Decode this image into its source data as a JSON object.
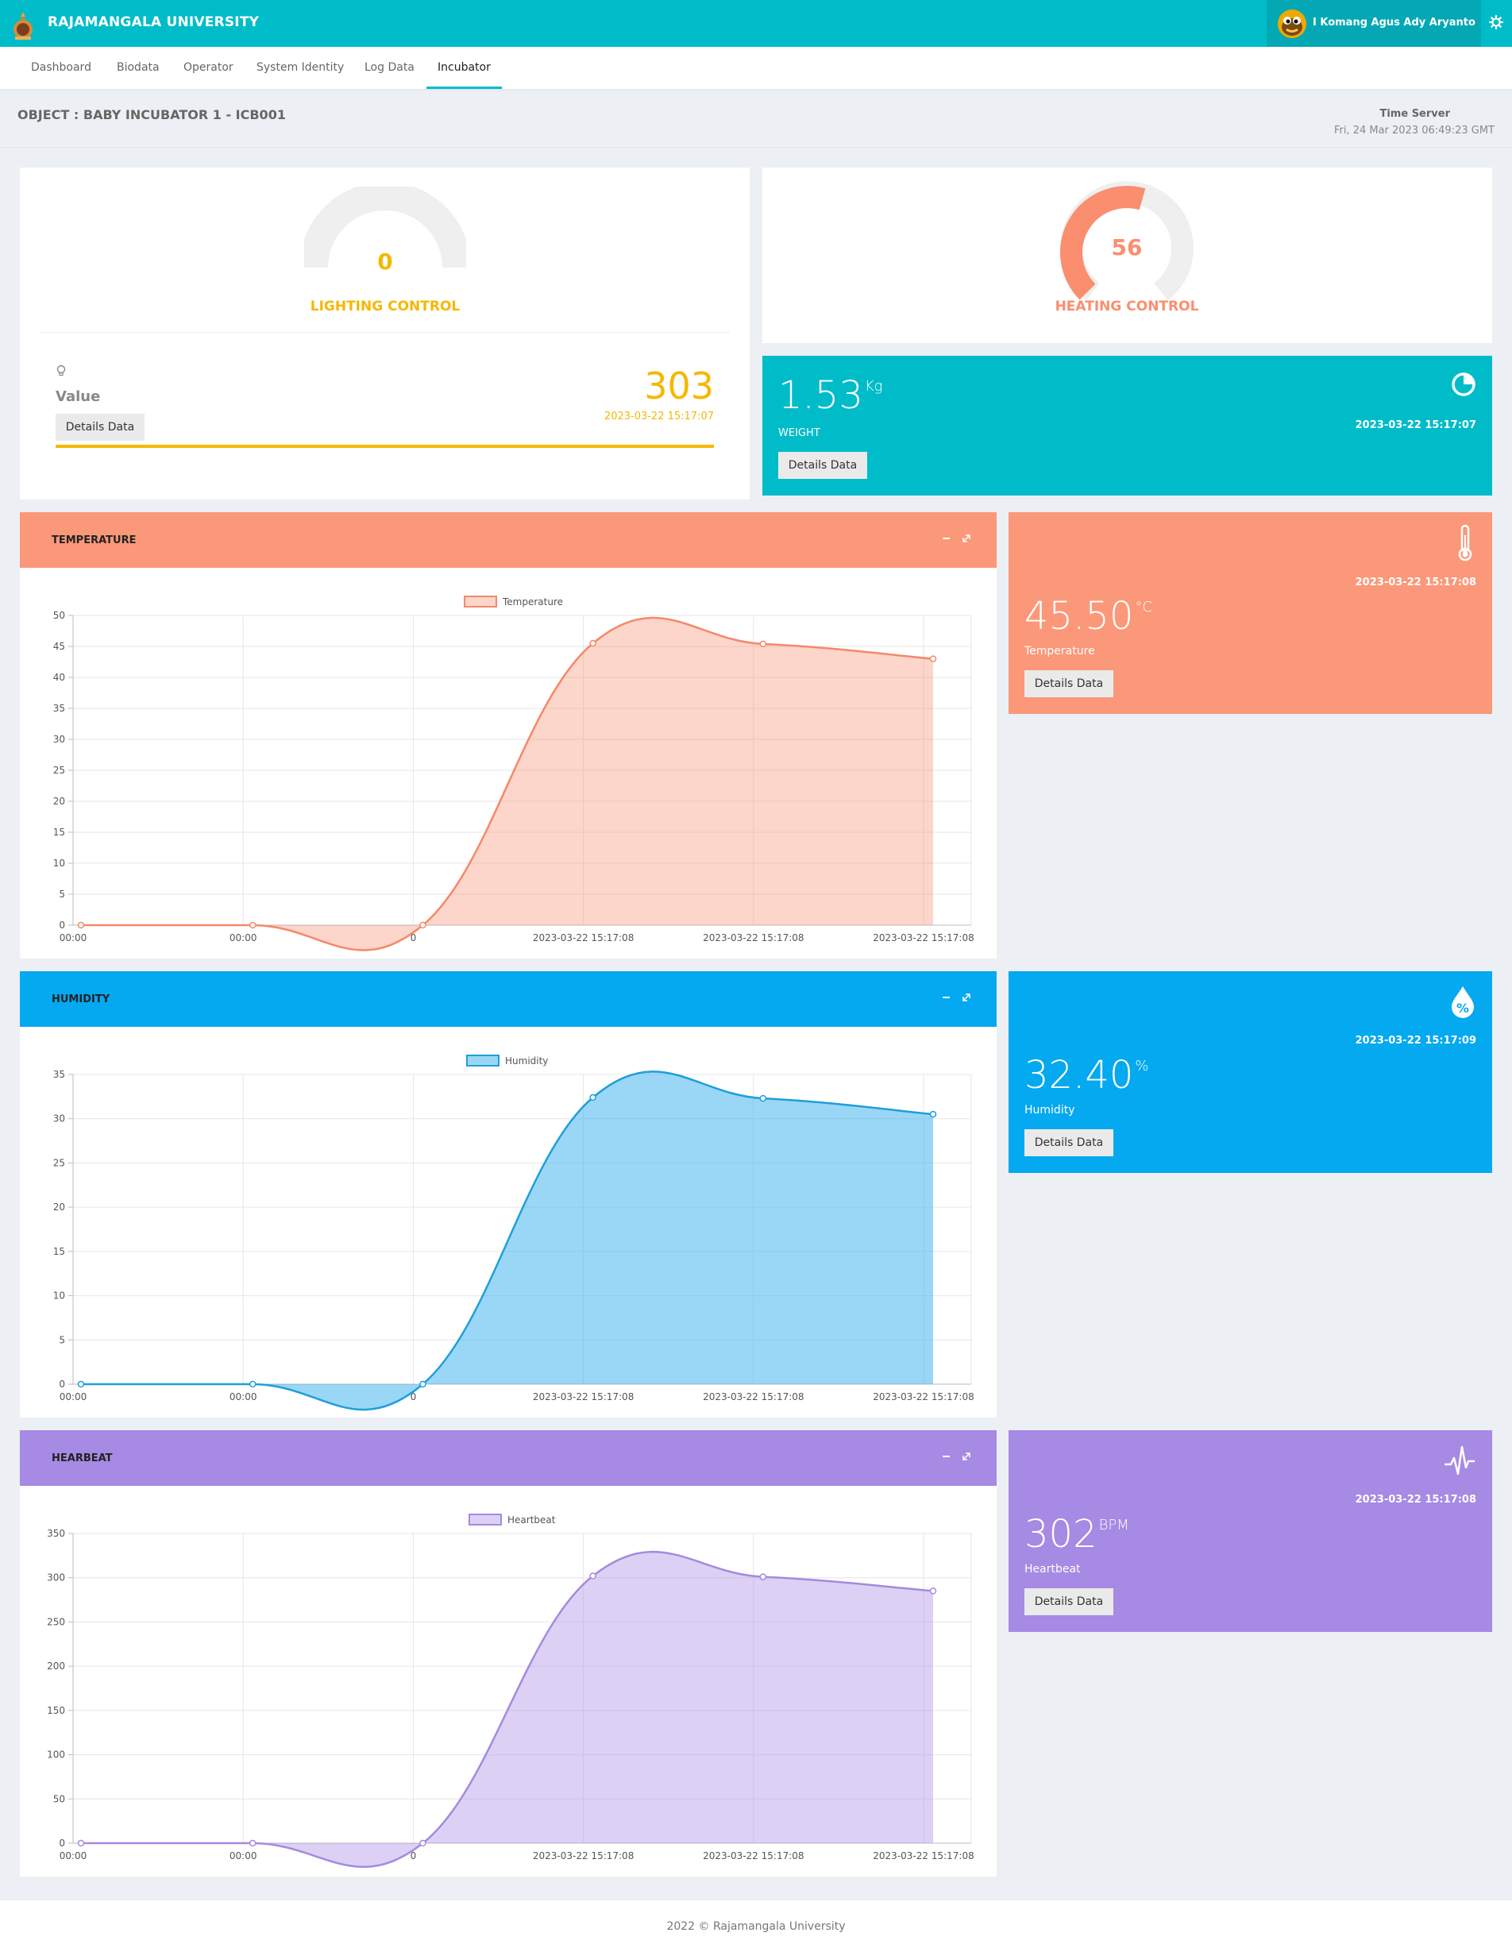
{
  "header": {
    "brand": "RAJAMANGALA UNIVERSITY",
    "user_name": "I Komang Agus Ady Aryanto",
    "icons": [
      "university-logo",
      "user-avatar",
      "gear-icon"
    ]
  },
  "nav": {
    "tabs": [
      {
        "label": "Dashboard"
      },
      {
        "label": "Biodata"
      },
      {
        "label": "Operator"
      },
      {
        "label": "System Identity"
      },
      {
        "label": "Log Data"
      },
      {
        "label": "Incubator"
      }
    ],
    "active": "Incubator"
  },
  "object": {
    "title": "OBJECT : BABY INCUBATOR 1 - ICB001",
    "time_label": "Time Server",
    "time_value": "Fri, 24 Mar 2023 06:49:23 GMT"
  },
  "lighting": {
    "gauge_value": "0",
    "gauge_fraction": 0,
    "label": "LIGHTING CONTROL",
    "value_title": "Value",
    "value": "303",
    "date": "2023-03-22 15:17:07",
    "button": "Details Data",
    "color": "#f5b800"
  },
  "heating": {
    "gauge_value": "56",
    "gauge_fraction": 0.56,
    "label": "HEATING CONTROL",
    "color": "#fa8e6e"
  },
  "weight": {
    "value": "1.53",
    "unit": "Kg",
    "label": "WEIGHT",
    "date": "2023-03-22 15:17:07",
    "button": "Details Data",
    "color": "#00bcc9",
    "icon": "moon-icon"
  },
  "temperature_widget": {
    "value": "45.50",
    "unit": "°C",
    "label": "Temperature",
    "date": "2023-03-22 15:17:08",
    "button": "Details Data",
    "color": "#fa9879",
    "icon": "thermometer-icon"
  },
  "humidity_widget": {
    "value": "32.40",
    "unit": "%",
    "label": "Humidity",
    "date": "2023-03-22 15:17:09",
    "button": "Details Data",
    "color": "#04a9ef",
    "icon": "humidity-drop-icon"
  },
  "heartbeat_widget": {
    "value": "302",
    "unit": "BPM",
    "label": "Heartbeat",
    "date": "2023-03-22 15:17:08",
    "button": "Details Data",
    "color": "#a68ae3",
    "icon": "pulse-icon"
  },
  "panels": {
    "temperature": {
      "title": "TEMPERATURE",
      "color": "#fa9879"
    },
    "humidity": {
      "title": "HUMIDITY",
      "color": "#04a9ef"
    },
    "heartbeat": {
      "title": "HEARBEAT",
      "color": "#a68ae3"
    }
  },
  "chart_data": [
    {
      "type": "area",
      "x": [
        "00:00",
        "00:00",
        "0",
        "2023-03-22 15:17:08",
        "2023-03-22 15:17:08",
        "2023-03-22 15:17:08"
      ],
      "series": [
        {
          "name": "Temperature",
          "values": [
            0,
            0,
            0,
            45.5,
            45.4,
            43
          ]
        }
      ],
      "ylim": [
        0,
        50
      ],
      "yticks": [
        0,
        5,
        10,
        15,
        20,
        25,
        30,
        35,
        40,
        45,
        50
      ],
      "color": "#f4896a",
      "fill": "rgba(247,145,118,0.38)",
      "legend": "top-center",
      "grid": true
    },
    {
      "type": "area",
      "x": [
        "00:00",
        "00:00",
        "0",
        "2023-03-22 15:17:08",
        "2023-03-22 15:17:08",
        "2023-03-22 15:17:08"
      ],
      "series": [
        {
          "name": "Humidity",
          "values": [
            0,
            0,
            0,
            32.4,
            32.3,
            30.5
          ]
        }
      ],
      "ylim": [
        0,
        35
      ],
      "yticks": [
        0,
        5,
        10,
        15,
        20,
        25,
        30,
        35
      ],
      "color": "#1f9fd8",
      "fill": "rgba(54,176,238,0.5)",
      "legend": "top-center",
      "grid": true
    },
    {
      "type": "area",
      "x": [
        "00:00",
        "00:00",
        "0",
        "2023-03-22 15:17:08",
        "2023-03-22 15:17:08",
        "2023-03-22 15:17:08"
      ],
      "series": [
        {
          "name": "Heartbeat",
          "values": [
            0,
            0,
            0,
            302,
            301,
            285
          ]
        }
      ],
      "ylim": [
        0,
        350
      ],
      "yticks": [
        0,
        50,
        100,
        150,
        200,
        250,
        300,
        350
      ],
      "color": "#a48ae0",
      "fill": "rgba(168,140,228,0.4)",
      "legend": "top-center",
      "grid": true
    }
  ],
  "footer": {
    "text": "2022 © Rajamangala University"
  }
}
